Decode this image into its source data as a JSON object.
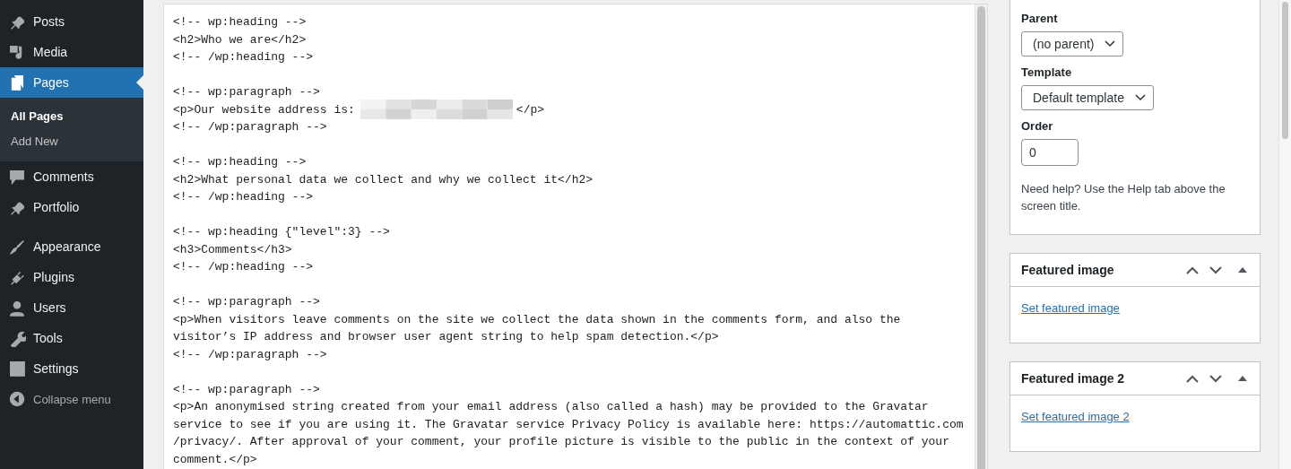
{
  "sidebar": {
    "groups": [
      [
        {
          "label": "Posts",
          "kind": "menu",
          "selected": false
        },
        {
          "label": "Media",
          "kind": "menu",
          "selected": false
        },
        {
          "label": "Pages",
          "kind": "menu",
          "selected": true,
          "children": [
            {
              "label": "All Pages",
              "selected": true
            },
            {
              "label": "Add New",
              "selected": false
            }
          ]
        },
        {
          "label": "Comments",
          "kind": "menu",
          "selected": false
        },
        {
          "label": "Portfolio",
          "kind": "menu",
          "selected": false
        }
      ],
      [
        {
          "label": "Appearance",
          "kind": "menu",
          "selected": false
        },
        {
          "label": "Plugins",
          "kind": "menu",
          "selected": false
        },
        {
          "label": "Users",
          "kind": "menu",
          "selected": false
        },
        {
          "label": "Tools",
          "kind": "menu",
          "selected": false
        },
        {
          "label": "Settings",
          "kind": "menu",
          "selected": false
        },
        {
          "label": "Collapse menu",
          "kind": "collapse",
          "selected": false
        }
      ]
    ]
  },
  "editor": {
    "blocks": [
      [
        {
          "text": "<!-- wp:heading -->"
        },
        {
          "text": "<h2>Who we are</h2>"
        },
        {
          "text": "<!-- /wp:heading -->"
        }
      ],
      [
        {
          "text": "<!-- wp:paragraph -->"
        },
        {
          "text": "<p>Our website address is:",
          "redacted": true,
          "after": "</p>"
        },
        {
          "text": "<!-- /wp:paragraph -->"
        }
      ],
      [
        {
          "text": "<!-- wp:heading -->"
        },
        {
          "text": "<h2>What personal data we collect and why we collect it</h2>"
        },
        {
          "text": "<!-- /wp:heading -->"
        }
      ],
      [
        {
          "text": "<!-- wp:heading {\"level\":3} -->"
        },
        {
          "text": "<h3>Comments</h3>"
        },
        {
          "text": "<!-- /wp:heading -->"
        }
      ],
      [
        {
          "text": "<!-- wp:paragraph -->"
        },
        {
          "text": "<p>When visitors leave comments on the site we collect the data shown in the comments form, and also the"
        },
        {
          "text": "visitor’s IP address and browser user agent string to help spam detection.</p>"
        },
        {
          "text": "<!-- /wp:paragraph -->"
        }
      ],
      [
        {
          "text": "<!-- wp:paragraph -->"
        },
        {
          "text": "<p>An anonymised string created from your email address (also called a hash) may be provided to the Gravatar"
        },
        {
          "text": "service to see if you are using it. The Gravatar service Privacy Policy is available here: https://automattic.com"
        },
        {
          "text": "/privacy/. After approval of your comment, your profile picture is visible to the public in the context of your"
        },
        {
          "text": "comment.</p>"
        }
      ]
    ]
  },
  "page_attributes": {
    "fields": [
      {
        "label": "Parent",
        "kind": "select",
        "value": "(no parent)"
      },
      {
        "label": "Template",
        "kind": "select",
        "value": "Default template"
      },
      {
        "label": "Order",
        "kind": "number",
        "value": "0"
      }
    ],
    "help": "Need help? Use the Help tab above the screen title."
  },
  "boxes": [
    {
      "title": "Featured image",
      "link": "Set featured image"
    },
    {
      "title": "Featured image 2",
      "link": "Set featured image 2"
    }
  ]
}
